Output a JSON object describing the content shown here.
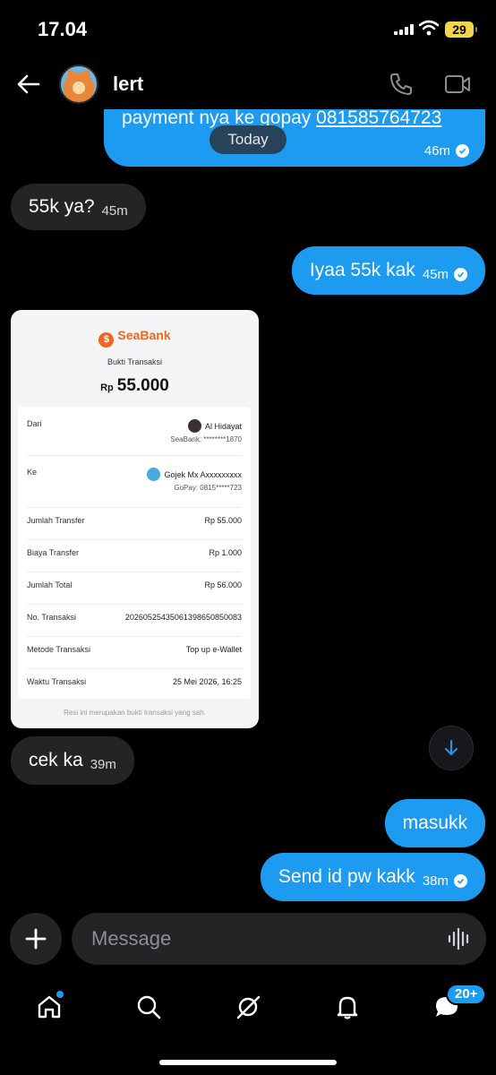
{
  "status_bar": {
    "time": "17.04",
    "battery": "29"
  },
  "header": {
    "contact_name": "lert"
  },
  "chat": {
    "first_message": {
      "text": "payment nya ke gopay ",
      "link": "081585764723",
      "time": "46m"
    },
    "date_separator": "Today",
    "messages": [
      {
        "direction": "in",
        "text": "55k ya?",
        "time": "45m"
      },
      {
        "direction": "out",
        "text": "Iyaa 55k kak",
        "time": "45m"
      },
      {
        "direction": "in",
        "text": "cek ka",
        "time": "39m"
      },
      {
        "direction": "out",
        "text": "masukk",
        "time": ""
      },
      {
        "direction": "out",
        "text": "Send id pw kakk",
        "time": "38m"
      }
    ]
  },
  "receipt": {
    "brand": "SeaBank",
    "title": "Bukti Transaksi",
    "currency": "Rp",
    "amount": "55.000",
    "from_label": "Dari",
    "from_name": "Al Hidayat",
    "from_account": "SeaBank: ********1870",
    "to_label": "Ke",
    "to_name": "Gojek Mx Axxxxxxxxx",
    "to_account": "GoPay: 0815*****723",
    "rows": [
      {
        "label": "Jumlah Transfer",
        "value": "Rp 55.000"
      },
      {
        "label": "Biaya Transfer",
        "value": "Rp 1.000"
      },
      {
        "label": "Jumlah Total",
        "value": "Rp 56.000"
      },
      {
        "label": "No. Transaksi",
        "value": "20260525435061398650850083"
      },
      {
        "label": "Metode Transaksi",
        "value": "Top up e-Wallet"
      },
      {
        "label": "Waktu Transaksi",
        "value": "25 Mei 2026, 16:25"
      }
    ],
    "footer": "Resi ini merupakan bukti transaksi yang sah."
  },
  "composer": {
    "placeholder": "Message"
  },
  "nav": {
    "messages_badge": "20+"
  },
  "colors": {
    "accent": "#1d9bf0",
    "incoming_bubble": "#222426",
    "seabank_orange": "#f16622",
    "battery": "#f2d64a"
  }
}
